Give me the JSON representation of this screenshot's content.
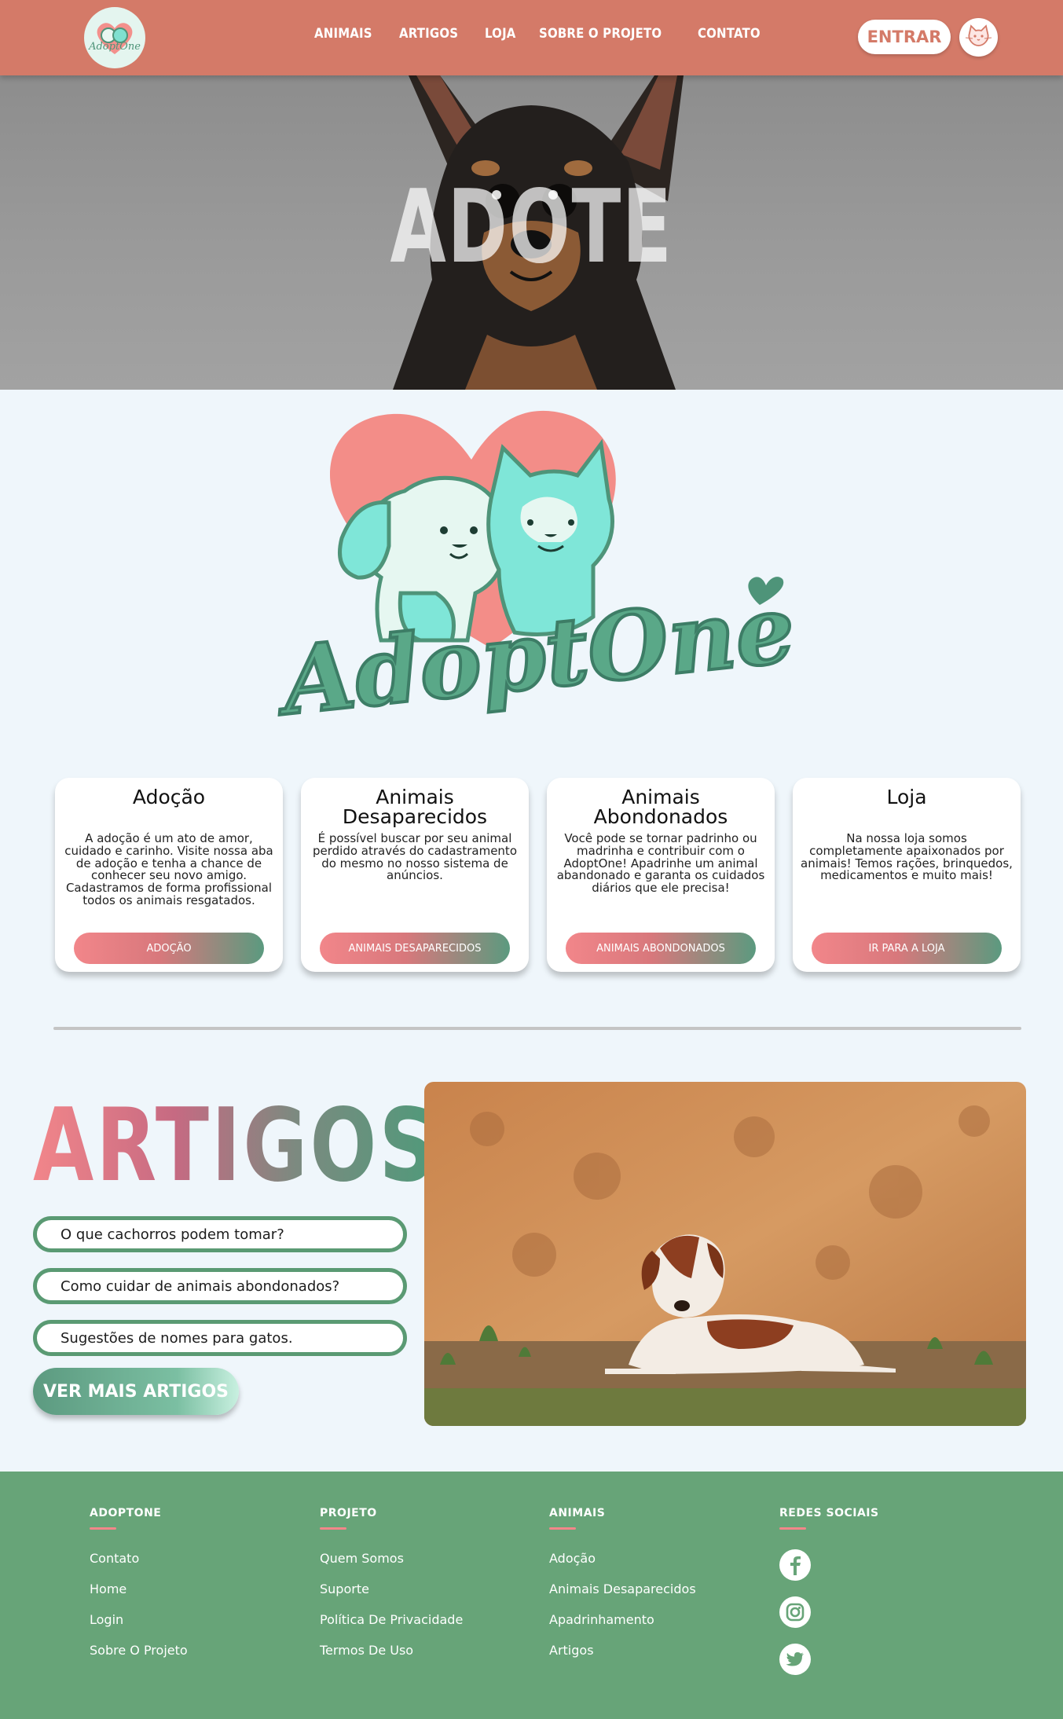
{
  "header": {
    "nav": [
      "ANIMAIS",
      "ARTIGOS",
      "LOJA",
      "SOBRE O PROJETO",
      "CONTATO"
    ],
    "login_label": "ENTRAR",
    "logo_text": "AdoptOne"
  },
  "hero": {
    "title": "ADOTE"
  },
  "brand": {
    "name": "AdoptOne"
  },
  "cards": [
    {
      "title": "Adoção",
      "text": "A adoção é um ato de amor, cuidado e carinho. Visite nossa aba de adoção e tenha a chance de conhecer seu novo amigo. Cadastramos de forma profissional todos os animais resgatados.",
      "button": "ADOÇÃO"
    },
    {
      "title": "Animais Desaparecidos",
      "text": "É possível buscar por seu animal perdido através do cadastramento do mesmo no nosso sistema de anúncios.",
      "button": "ANIMAIS DESAPARECIDOS"
    },
    {
      "title": "Animais Abondonados",
      "text": "Você pode se tornar padrinho ou madrinha e contribuir com o AdoptOne! Apadrinhe um animal abandonado e garanta os cuidados diários que ele precisa!",
      "button": "ANIMAIS ABONDONADOS"
    },
    {
      "title": "Loja",
      "text": "Na nossa loja somos completamente apaixonados por animais! Temos rações, brinquedos, medicamentos e muito mais!",
      "button": "IR PARA A LOJA"
    }
  ],
  "articles": {
    "title": "ARTIGOS",
    "items": [
      "O que cachorros podem tomar?",
      "Como cuidar de animais abondonados?",
      "Sugestões de nomes para gatos."
    ],
    "more_label": "VER MAIS ARTIGOS"
  },
  "footer": {
    "columns": [
      {
        "title": "ADOPTONE",
        "links": [
          "Contato",
          "Home",
          "Login",
          "Sobre O Projeto"
        ]
      },
      {
        "title": "PROJETO",
        "links": [
          "Quem Somos",
          "Suporte",
          "Política De Privacidade",
          "Termos De Uso"
        ]
      },
      {
        "title": "ANIMAIS",
        "links": [
          "Adoção",
          "Animais Desaparecidos",
          "Apadrinhamento",
          "Artigos"
        ]
      }
    ],
    "social_title": "REDES SOCIAIS",
    "social": [
      "facebook-icon",
      "instagram-icon",
      "twitter-icon"
    ]
  },
  "colors": {
    "header": "#d47a68",
    "footer": "#67a478",
    "accent_pink": "#f2868a",
    "accent_green": "#5a9a73",
    "background": "#eff6fb"
  }
}
